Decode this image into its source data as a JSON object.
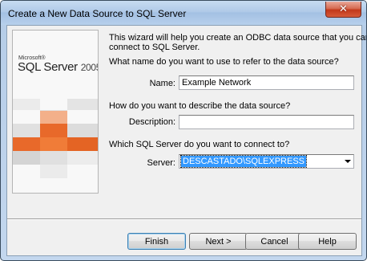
{
  "window": {
    "title": "Create a New Data Source to SQL Server",
    "close_glyph": "✕"
  },
  "logo": {
    "brand": "Microsoft®",
    "product": "SQL Server",
    "version": "2005"
  },
  "intro": {
    "line1": "This wizard will help you create an ODBC data source that you can use to",
    "line2": "connect to SQL Server."
  },
  "name_section": {
    "question": "What name do you want to use to refer to the data source?",
    "label": "Name:",
    "value": "Example Network"
  },
  "description_section": {
    "question": "How do you want to describe the data source?",
    "label": "Description:",
    "value": ""
  },
  "server_section": {
    "question": "Which SQL Server do you want to connect to?",
    "label": "Server:",
    "value": "DESCASTADO\\SQLEXPRESS"
  },
  "buttons": {
    "finish": "Finish",
    "next": "Next >",
    "cancel": "Cancel",
    "help": "Help"
  },
  "colors": {
    "accent_orange": "#e8692a",
    "selection_blue": "#3399ff",
    "close_red": "#c2381b"
  }
}
